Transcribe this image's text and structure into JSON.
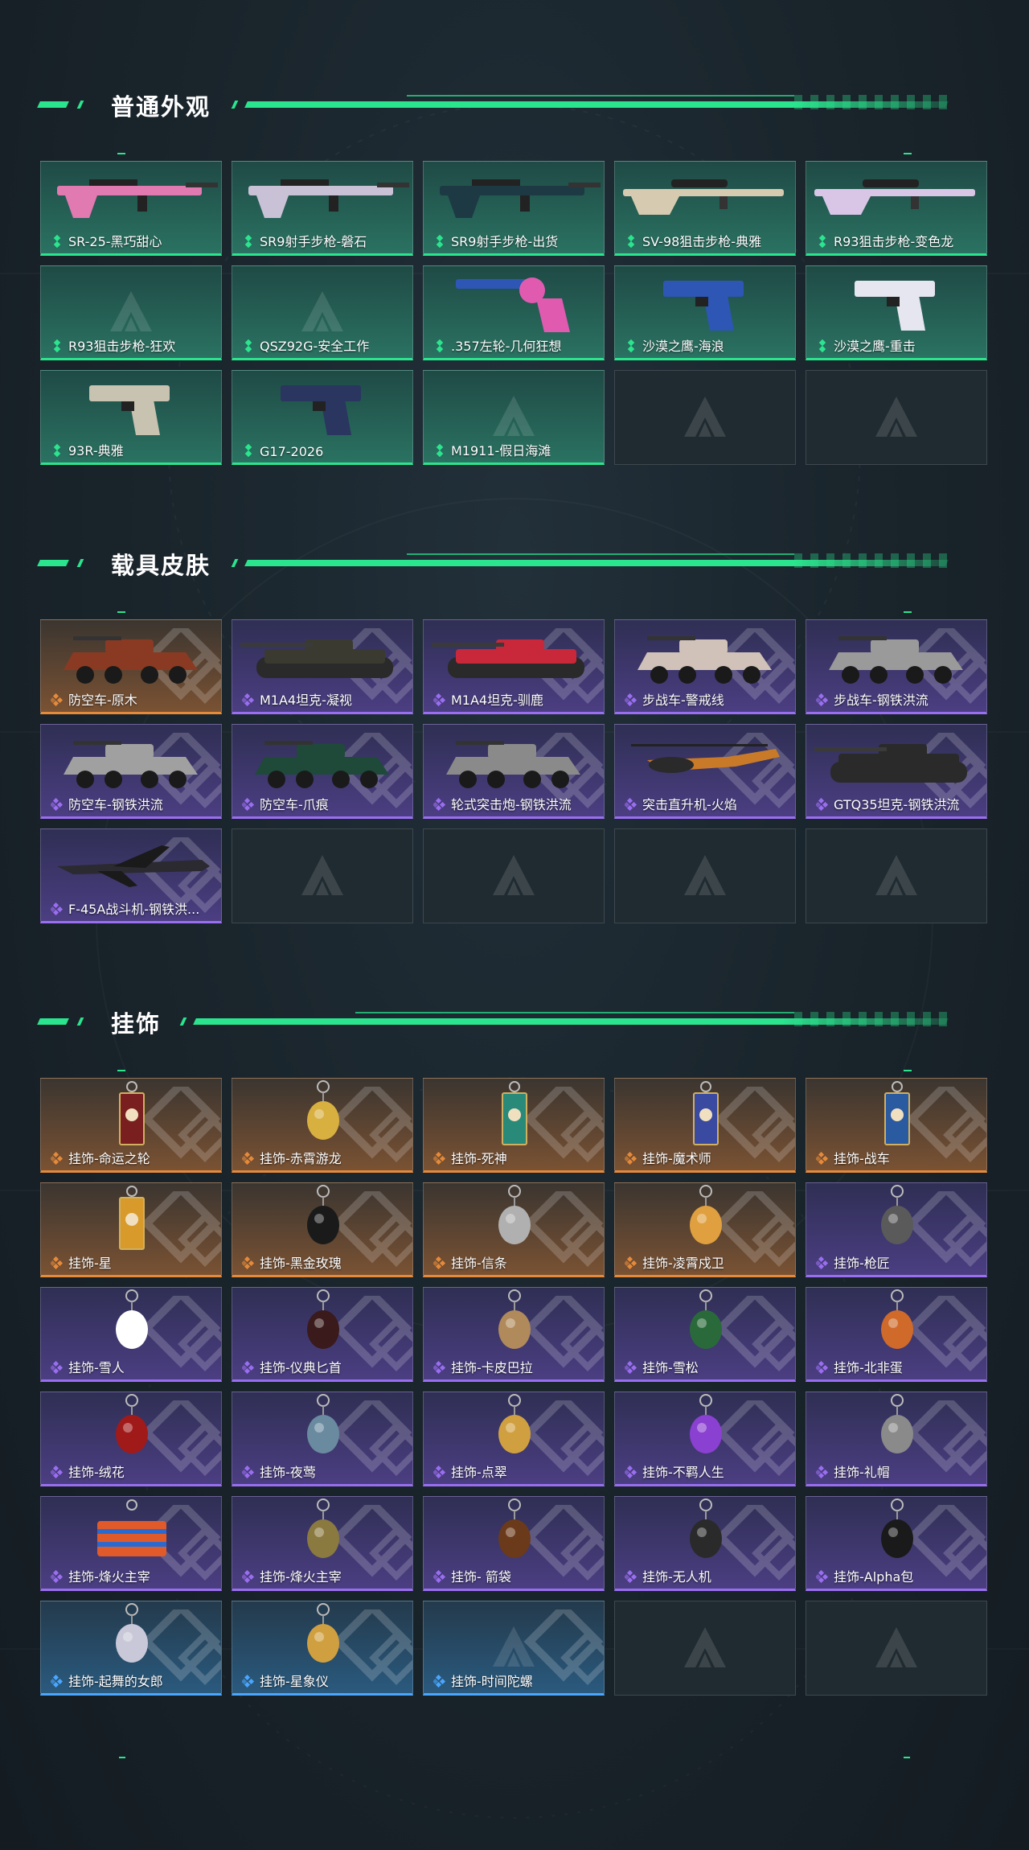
{
  "sections": [
    {
      "title": "普通外观",
      "items": [
        {
          "label": "SR-25-黑巧甜心",
          "rarity": "green",
          "art": "rifle",
          "color": "#e07ab0"
        },
        {
          "label": "SR9射手步枪-磐石",
          "rarity": "green",
          "art": "rifle",
          "color": "#c9c1d6"
        },
        {
          "label": "SR9射手步枪-出货",
          "rarity": "green",
          "art": "rifle",
          "color": "#1d3a44"
        },
        {
          "label": "SV-98狙击步枪-典雅",
          "rarity": "green",
          "art": "sniper",
          "color": "#d6cbb0"
        },
        {
          "label": "R93狙击步枪-变色龙",
          "rarity": "green",
          "art": "sniper",
          "color": "#d9c6e6"
        },
        {
          "label": "R93狙击步枪-狂欢",
          "rarity": "green",
          "art": "none",
          "color": ""
        },
        {
          "label": "QSZ92G-安全工作",
          "rarity": "green",
          "art": "none",
          "color": ""
        },
        {
          "label": ".357左轮-几何狂想",
          "rarity": "green",
          "art": "revolver",
          "color": "#e05bb0"
        },
        {
          "label": "沙漠之鹰-海浪",
          "rarity": "green",
          "art": "pistol",
          "color": "#2d56b5"
        },
        {
          "label": "沙漠之鹰-重击",
          "rarity": "green",
          "art": "pistol",
          "color": "#e6e6f0"
        },
        {
          "label": "93R-典雅",
          "rarity": "green",
          "art": "pistol",
          "color": "#c8c2b0"
        },
        {
          "label": "G17-2026",
          "rarity": "green",
          "art": "pistol",
          "color": "#2a3560"
        },
        {
          "label": "M1911-假日海滩",
          "rarity": "green",
          "art": "none",
          "color": ""
        },
        {
          "label": "",
          "rarity": "empty",
          "art": "none",
          "color": ""
        },
        {
          "label": "",
          "rarity": "empty",
          "art": "none",
          "color": ""
        }
      ]
    },
    {
      "title": "载具皮肤",
      "items": [
        {
          "label": "防空车-原木",
          "rarity": "orange",
          "art": "apc",
          "color": "#8a3a22"
        },
        {
          "label": "M1A4坦克-凝视",
          "rarity": "purple",
          "art": "tank",
          "color": "#3a3a30"
        },
        {
          "label": "M1A4坦克-驯鹿",
          "rarity": "purple",
          "art": "tank",
          "color": "#c8283a"
        },
        {
          "label": "步战车-警戒线",
          "rarity": "purple",
          "art": "apc",
          "color": "#d0c2b8"
        },
        {
          "label": "步战车-钢铁洪流",
          "rarity": "purple",
          "art": "apc",
          "color": "#9a9a9a"
        },
        {
          "label": "防空车-钢铁洪流",
          "rarity": "purple",
          "art": "apc",
          "color": "#a0a0a0"
        },
        {
          "label": "防空车-爪痕",
          "rarity": "purple",
          "art": "apc",
          "color": "#1f4a3a"
        },
        {
          "label": "轮式突击炮-钢铁洪流",
          "rarity": "purple",
          "art": "apc",
          "color": "#8a8a8a"
        },
        {
          "label": "突击直升机-火焰",
          "rarity": "purple",
          "art": "heli",
          "color": "#c87a28"
        },
        {
          "label": "GTQ35坦克-钢铁洪流",
          "rarity": "purple",
          "art": "tank",
          "color": "#2a2a2a"
        },
        {
          "label": "F-45A战斗机-钢铁洪...",
          "rarity": "purple",
          "art": "jet",
          "color": "#2a2a30"
        },
        {
          "label": "",
          "rarity": "empty",
          "art": "none",
          "color": ""
        },
        {
          "label": "",
          "rarity": "empty",
          "art": "none",
          "color": ""
        },
        {
          "label": "",
          "rarity": "empty",
          "art": "none",
          "color": ""
        },
        {
          "label": "",
          "rarity": "empty",
          "art": "none",
          "color": ""
        }
      ]
    },
    {
      "title": "挂饰",
      "items": [
        {
          "label": "挂饰-命运之轮",
          "rarity": "orange",
          "art": "card",
          "color": "#7a1f1f"
        },
        {
          "label": "挂饰-赤霄游龙",
          "rarity": "orange",
          "art": "charm",
          "color": "#d8b040"
        },
        {
          "label": "挂饰-死神",
          "rarity": "orange",
          "art": "card",
          "color": "#2a8a7a"
        },
        {
          "label": "挂饰-魔术师",
          "rarity": "orange",
          "art": "card",
          "color": "#3a4aa0"
        },
        {
          "label": "挂饰-战车",
          "rarity": "orange",
          "art": "card",
          "color": "#2a5aa0"
        },
        {
          "label": "挂饰-星",
          "rarity": "orange",
          "art": "card",
          "color": "#d89a2a"
        },
        {
          "label": "挂饰-黑金玫瑰",
          "rarity": "orange",
          "art": "charm",
          "color": "#1a1a1a"
        },
        {
          "label": "挂饰-信条",
          "rarity": "orange",
          "art": "charm",
          "color": "#b0b0b0"
        },
        {
          "label": "挂饰-凌霄戍卫",
          "rarity": "orange",
          "art": "charm",
          "color": "#e0a040"
        },
        {
          "label": "挂饰-枪匠",
          "rarity": "purple",
          "art": "charm",
          "color": "#5a5a5a"
        },
        {
          "label": "挂饰-雪人",
          "rarity": "purple",
          "art": "charm",
          "color": "#ffffff"
        },
        {
          "label": "挂饰-仪典匕首",
          "rarity": "purple",
          "art": "charm",
          "color": "#3a1a1a"
        },
        {
          "label": "挂饰-卡皮巴拉",
          "rarity": "purple",
          "art": "charm",
          "color": "#b08a5a"
        },
        {
          "label": "挂饰-雪松",
          "rarity": "purple",
          "art": "charm",
          "color": "#2a6a3a"
        },
        {
          "label": "挂饰-北非蛋",
          "rarity": "purple",
          "art": "charm",
          "color": "#d06a2a"
        },
        {
          "label": "挂饰-绒花",
          "rarity": "purple",
          "art": "charm",
          "color": "#a01a1a"
        },
        {
          "label": "挂饰-夜莺",
          "rarity": "purple",
          "art": "charm",
          "color": "#6a8aa0"
        },
        {
          "label": "挂饰-点翠",
          "rarity": "purple",
          "art": "charm",
          "color": "#d0a040"
        },
        {
          "label": "挂饰-不羁人生",
          "rarity": "purple",
          "art": "charm",
          "color": "#8a40d0"
        },
        {
          "label": "挂饰-礼帽",
          "rarity": "purple",
          "art": "charm",
          "color": "#8a8a8a"
        },
        {
          "label": "挂饰-烽火主宰",
          "rarity": "purple",
          "art": "box",
          "color": "#e05a2a"
        },
        {
          "label": "挂饰-烽火主宰",
          "rarity": "purple",
          "art": "charm",
          "color": "#8a7a40"
        },
        {
          "label": "挂饰- 箭袋",
          "rarity": "purple",
          "art": "charm",
          "color": "#6a3a1a"
        },
        {
          "label": "挂饰-无人机",
          "rarity": "purple",
          "art": "charm",
          "color": "#2a2a2a"
        },
        {
          "label": "挂饰-Alpha包",
          "rarity": "purple",
          "art": "charm",
          "color": "#1a1a1a"
        },
        {
          "label": "挂饰-起舞的女郎",
          "rarity": "blue",
          "art": "charm",
          "color": "#c8c8d8"
        },
        {
          "label": "挂饰-星象仪",
          "rarity": "blue",
          "art": "charm",
          "color": "#d0a040"
        },
        {
          "label": "挂饰-时间陀螺",
          "rarity": "blue",
          "art": "none",
          "color": ""
        },
        {
          "label": "",
          "rarity": "empty",
          "art": "none",
          "color": ""
        },
        {
          "label": "",
          "rarity": "empty",
          "art": "none",
          "color": ""
        }
      ]
    }
  ],
  "colors": {
    "accent": "#2be58e",
    "green_rarity": "#2be58e",
    "orange_rarity": "#e58a3a",
    "purple_rarity": "#9a6ef0",
    "blue_rarity": "#4aa6ff"
  }
}
